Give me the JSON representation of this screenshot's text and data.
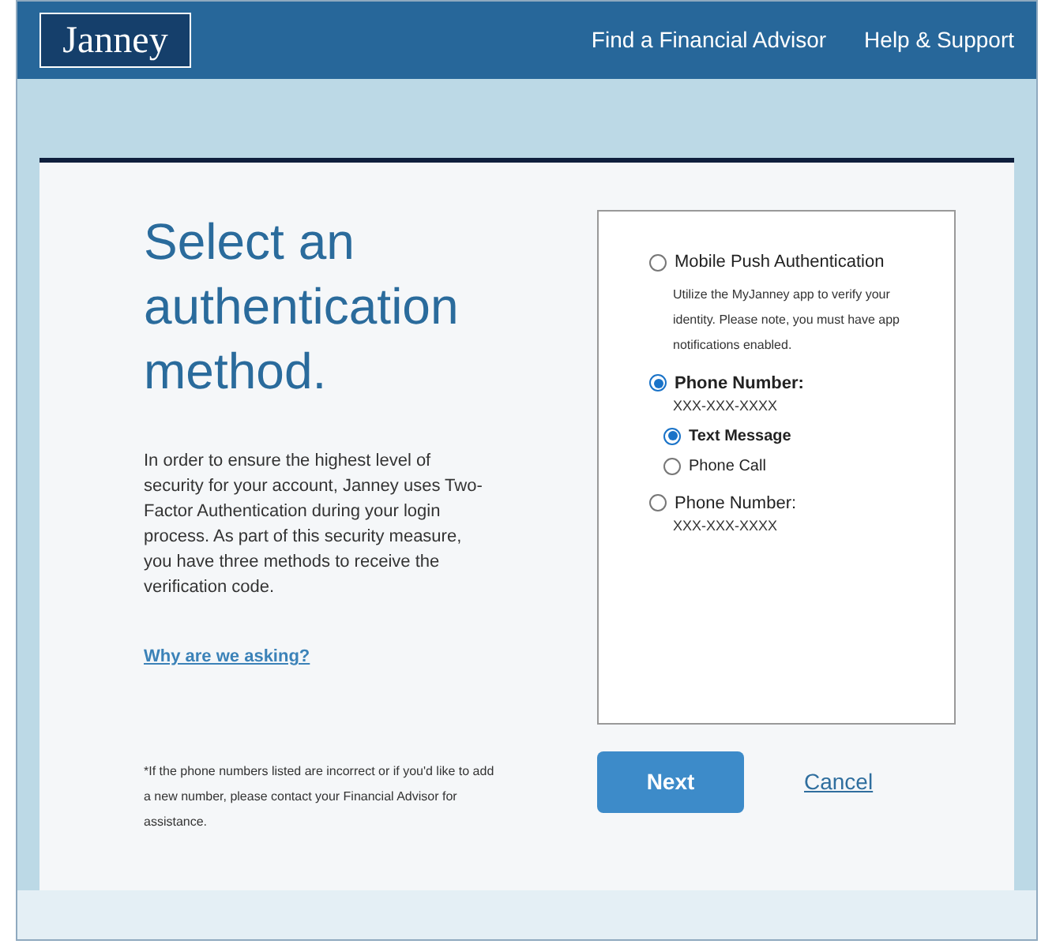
{
  "header": {
    "logo": "Janney",
    "links": [
      "Find a Financial Advisor",
      "Help & Support"
    ]
  },
  "title": "Select an authentication method.",
  "intro": "In order to ensure the highest level of security for your account, Janney uses Two-Factor Authentication during your login process. As part of this security measure, you have three methods to receive the verification code.",
  "why_link": "Why are we asking?",
  "footnote": "*If the phone numbers listed are incorrect or if you'd like to add a new number, please contact your Financial Advisor for assistance.",
  "options": [
    {
      "label": "Mobile Push Authentication",
      "selected": false,
      "description": "Utilize the MyJanney app to verify your identity. Please note, you must have app notifications enabled."
    },
    {
      "label": "Phone Number:",
      "selected": true,
      "number": "XXX-XXX-XXXX",
      "children": [
        {
          "label": "Text Message",
          "selected": true
        },
        {
          "label": "Phone Call",
          "selected": false
        }
      ]
    },
    {
      "label": "Phone Number:",
      "selected": false,
      "number": "XXX-XXX-XXXX"
    }
  ],
  "buttons": {
    "next": "Next",
    "cancel": "Cancel"
  }
}
